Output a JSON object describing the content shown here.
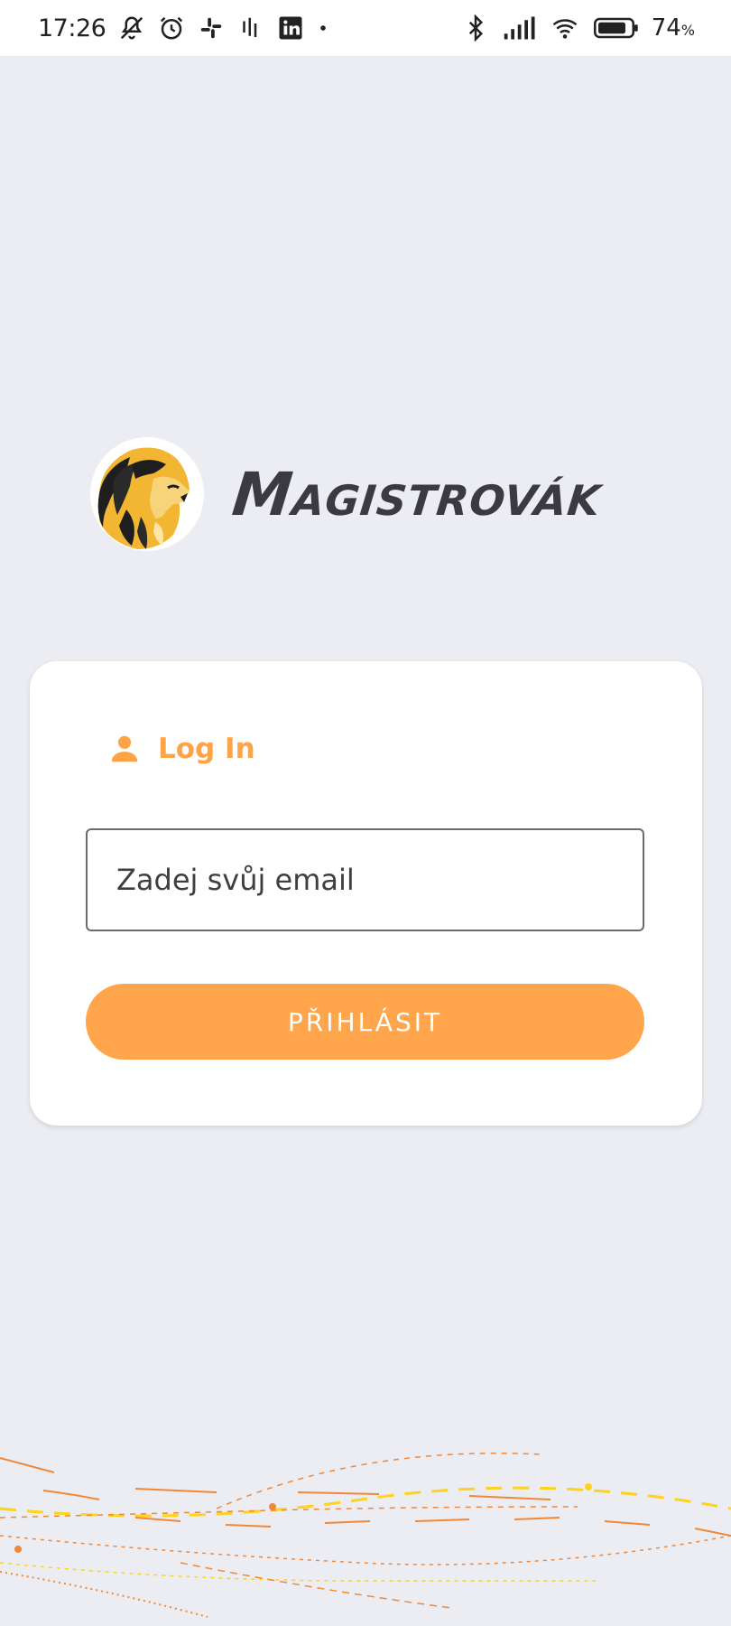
{
  "status_bar": {
    "time": "17:26",
    "battery_percent": "74",
    "battery_unit": "%",
    "icons_left": [
      "mute-notification-icon",
      "alarm-icon",
      "slack-icon",
      "voice-icon",
      "linkedin-icon",
      "dot-icon"
    ],
    "icons_right": [
      "bluetooth-icon",
      "signal-icon",
      "wifi-icon",
      "battery-icon"
    ]
  },
  "brand": {
    "name": "Magistrovák",
    "logo_icon": "lion-logo-icon"
  },
  "login": {
    "title": "Log In",
    "icon": "user-icon",
    "email_placeholder": "Zadej svůj email",
    "email_value": "",
    "submit_label": "PŘIHLÁSIT"
  },
  "colors": {
    "accent": "#FFA54B",
    "background": "#ECEDF2",
    "card": "#FFFFFF",
    "text_dark": "#3A3A40"
  }
}
